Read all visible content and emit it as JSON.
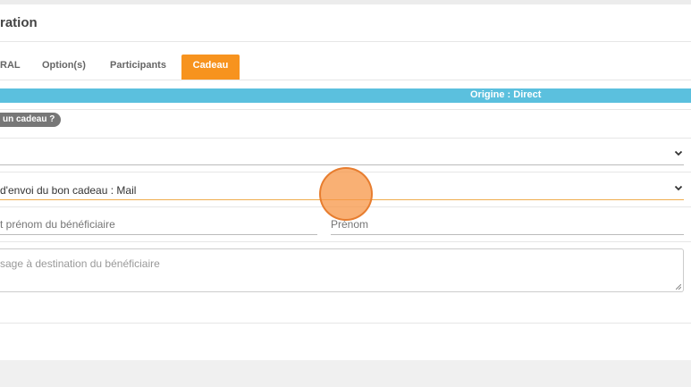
{
  "panel": {
    "title": "ration"
  },
  "tabs": [
    {
      "label": "RAL",
      "active": false
    },
    {
      "label": "Option(s)",
      "active": false
    },
    {
      "label": "Participants",
      "active": false
    },
    {
      "label": "Cadeau",
      "active": true
    }
  ],
  "origin": {
    "text": "Origine : Direct"
  },
  "gift": {
    "question_badge": "un cadeau ?",
    "first_select_value": "",
    "send_mode_select": "d'envoi du bon cadeau : Mail",
    "beneficiary_name_placeholder": "t prénom du bénéficiaire",
    "firstname_placeholder": "Prénom",
    "message_placeholder": "sage à destination du bénéficiaire"
  },
  "colors": {
    "accent": "#f7931e",
    "info_bar": "#5bc0de",
    "badge": "#777777"
  },
  "icons": [
    "chevron-down-icon",
    "resize-grip-icon"
  ]
}
